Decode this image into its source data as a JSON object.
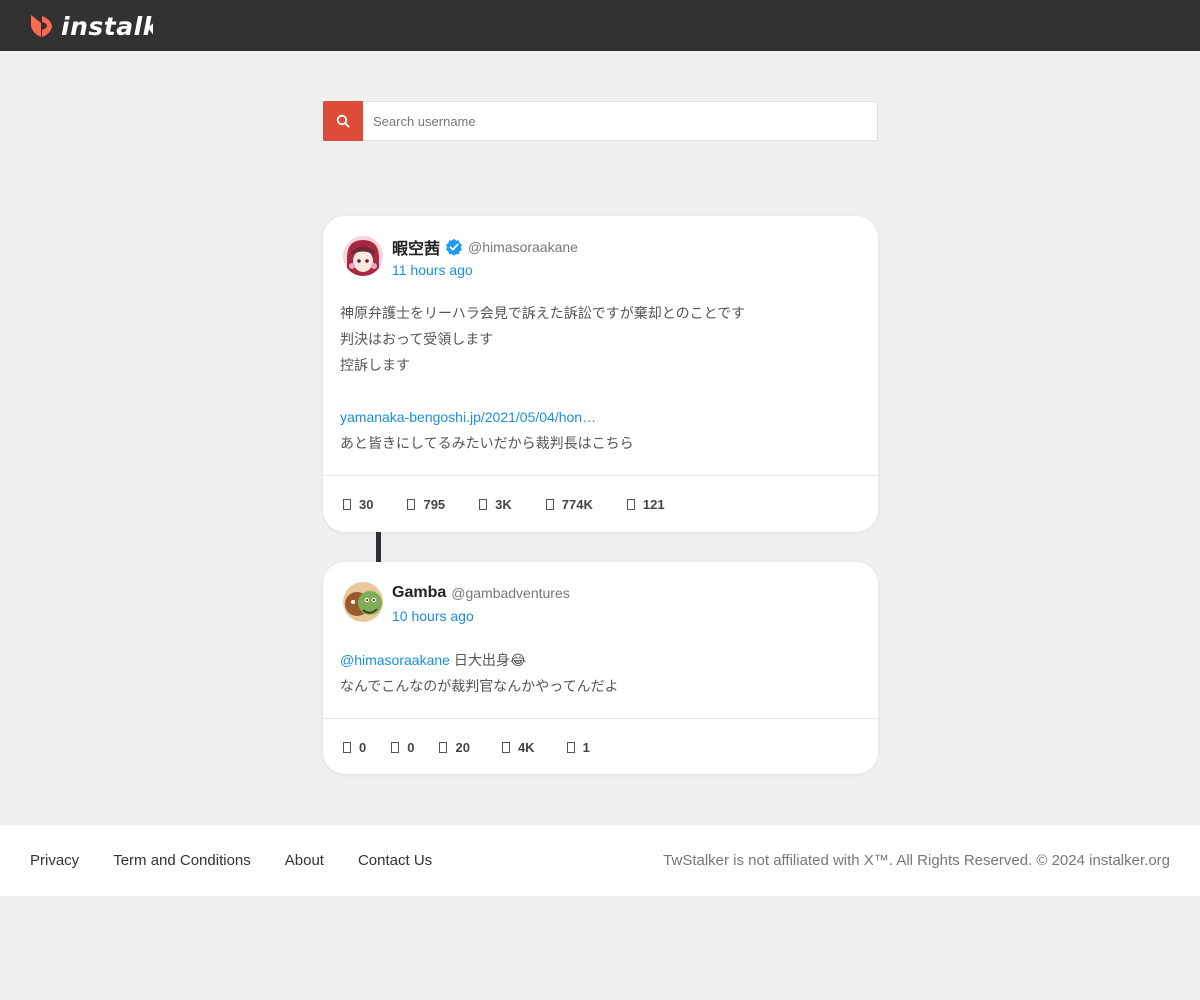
{
  "header": {
    "logo_text": "instalk",
    "logo_color": "#ff6a4d"
  },
  "search": {
    "placeholder": "Search username",
    "icon": "search-icon",
    "button_color": "#dd4b39"
  },
  "posts": [
    {
      "name": "暇空茜",
      "verified": true,
      "handle": "@himasoraakane",
      "time": "11 hours ago",
      "text": [
        "神原弁護士をリーハラ会見で訴えた訴訟ですが棄却とのことです",
        "判決はおって受領します",
        "控訴します"
      ],
      "link": "yamanaka-bengoshi.jp/2021/05/04/hon…",
      "text_after": "あと皆きにしてるみたいだから裁判長はこちら",
      "stats": {
        "replies": "30",
        "retweets": "795",
        "quotes": "3K",
        "views": "774K",
        "bookmarks": "121"
      }
    },
    {
      "name": "Gamba",
      "verified": false,
      "handle": "@gambadventures",
      "time": "10 hours ago",
      "mention": "@himasoraakane",
      "mention_text": " 日大出身😂",
      "text2": "なんでこんなのが裁判官なんかやってんだよ",
      "stats": {
        "replies": "0",
        "retweets": "0",
        "quotes": "20",
        "views": "4K",
        "bookmarks": "1"
      }
    }
  ],
  "footer": {
    "links": [
      "Privacy",
      "Term and Conditions",
      "About",
      "Contact Us"
    ],
    "note": "TwStalker is not affiliated with X™. All Rights Reserved. © 2024 instalker.org"
  },
  "colors": {
    "link": "#1a8fd8",
    "verified": "#1d9bf0",
    "topbar": "#323232"
  }
}
